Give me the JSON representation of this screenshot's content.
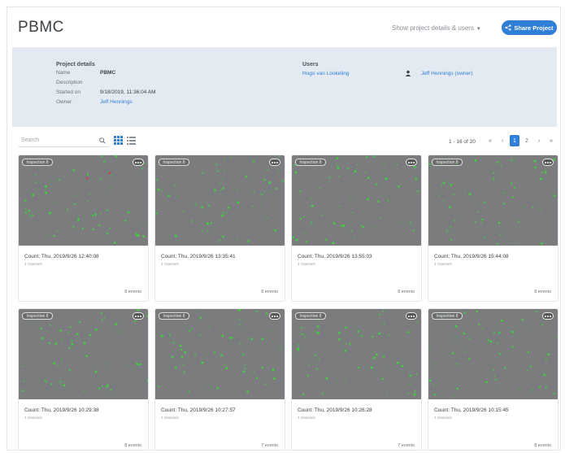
{
  "header": {
    "title": "PBMC",
    "show_details_label": "Show project details & users",
    "share_label": "Share Project"
  },
  "details": {
    "section_title": "Project details",
    "rows": [
      {
        "key": "Name",
        "value": "PBMC"
      },
      {
        "key": "Description",
        "value": ""
      },
      {
        "key": "Started on",
        "value": "9/18/2019, 11:36:04 AM"
      },
      {
        "key": "Owner",
        "value": "Jeff Hennings"
      }
    ],
    "users_title": "Users",
    "users": [
      "Hugo van Lookeling",
      "Jeff Hennings (owner)"
    ]
  },
  "toolbar": {
    "search_placeholder": "Search",
    "range": "1 - 16 of 20",
    "pages": [
      "«",
      "‹",
      "1",
      "2",
      "›",
      "»"
    ],
    "active_page": "1"
  },
  "cards": [
    {
      "badge": "Inspection 8",
      "title": "Count: Thu, 2019/9/26 12:40:08",
      "sub": "4 channels",
      "events": "8 events"
    },
    {
      "badge": "Inspection 8",
      "title": "Count: Thu, 2019/9/26 13:35:41",
      "sub": "4 channels",
      "events": "8 events"
    },
    {
      "badge": "Inspection 8",
      "title": "Count: Thu, 2019/9/26 13:55:03",
      "sub": "4 channels",
      "events": "8 events"
    },
    {
      "badge": "Inspection 8",
      "title": "Count: Thu, 2019/9/26 15:44:08",
      "sub": "4 channels",
      "events": "8 events"
    },
    {
      "badge": "Inspection 8",
      "title": "Count: Thu, 2019/9/26 10:29:38",
      "sub": "4 channels",
      "events": "8 events"
    },
    {
      "badge": "Inspection 8",
      "title": "Count: Thu, 2019/9/26 10:27:57",
      "sub": "4 channels",
      "events": "7 events"
    },
    {
      "badge": "Inspection 8",
      "title": "Count: Thu, 2019/9/26 10:26:28",
      "sub": "4 channels",
      "events": "7 events"
    },
    {
      "badge": "Inspection 8",
      "title": "Count: Thu, 2019/9/26 10:15:45",
      "sub": "4 channels",
      "events": "8 events"
    }
  ],
  "colors": {
    "accent": "#2f7ed8",
    "details_bg": "#e4eaf1",
    "image_bg": "#7b7c7d",
    "cell_green": "#3fd23a",
    "cell_red": "#d23a3a"
  }
}
